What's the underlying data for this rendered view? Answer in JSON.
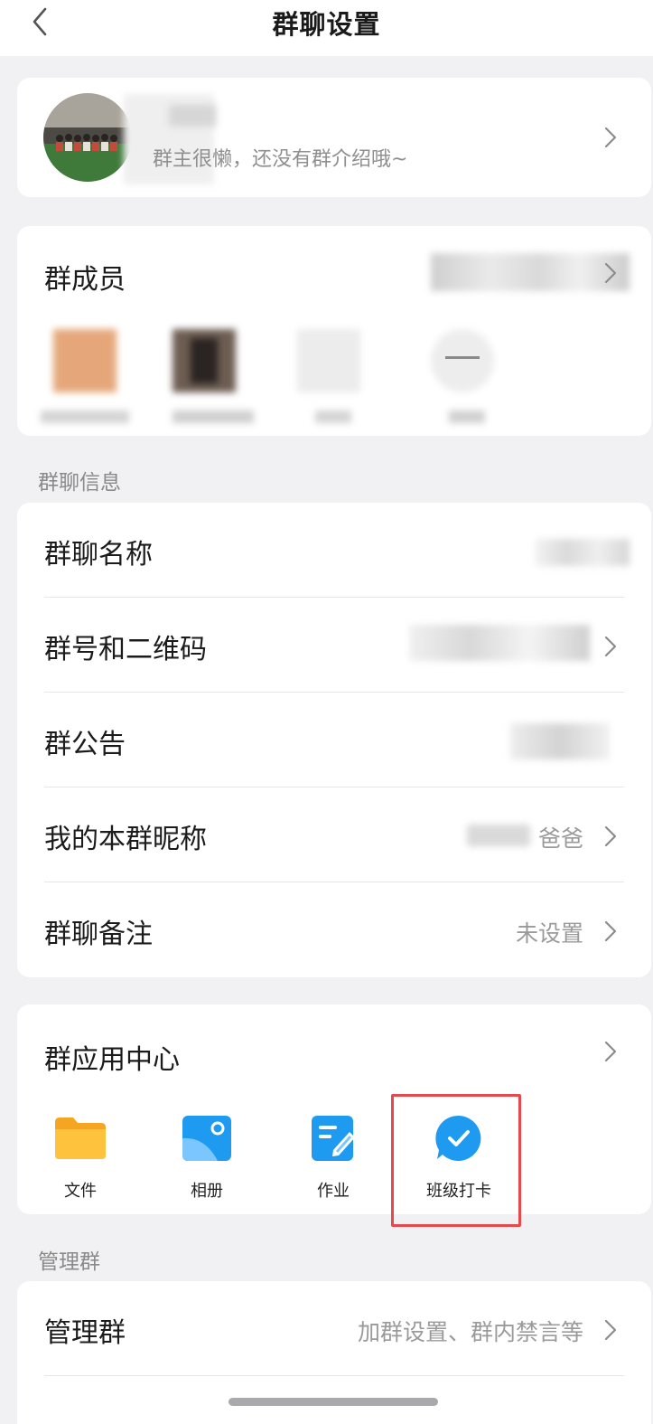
{
  "nav": {
    "title": "群聊设置"
  },
  "group": {
    "intro": "群主很懒，还没有群介绍哦~"
  },
  "members": {
    "title": "群成员"
  },
  "info": {
    "section_label": "群聊信息",
    "rows": [
      {
        "label": "群聊名称",
        "value": ""
      },
      {
        "label": "群号和二维码",
        "value": ""
      },
      {
        "label": "群公告",
        "value": ""
      },
      {
        "label": "我的本群昵称",
        "value": "爸爸"
      },
      {
        "label": "群聊备注",
        "value": "未设置"
      }
    ]
  },
  "apps": {
    "title": "群应用中心",
    "items": [
      {
        "label": "文件",
        "icon": "folder-icon"
      },
      {
        "label": "相册",
        "icon": "album-icon"
      },
      {
        "label": "作业",
        "icon": "homework-icon"
      },
      {
        "label": "班级打卡",
        "icon": "check-in-icon"
      }
    ],
    "highlight_color": "#e5484d"
  },
  "manage": {
    "section_label": "管理群",
    "row_label": "管理群",
    "row_value": "加群设置、群内禁言等"
  },
  "colors": {
    "accent": "#1e9bf0",
    "folder": "#ffb733",
    "background": "#f1f1f4"
  }
}
